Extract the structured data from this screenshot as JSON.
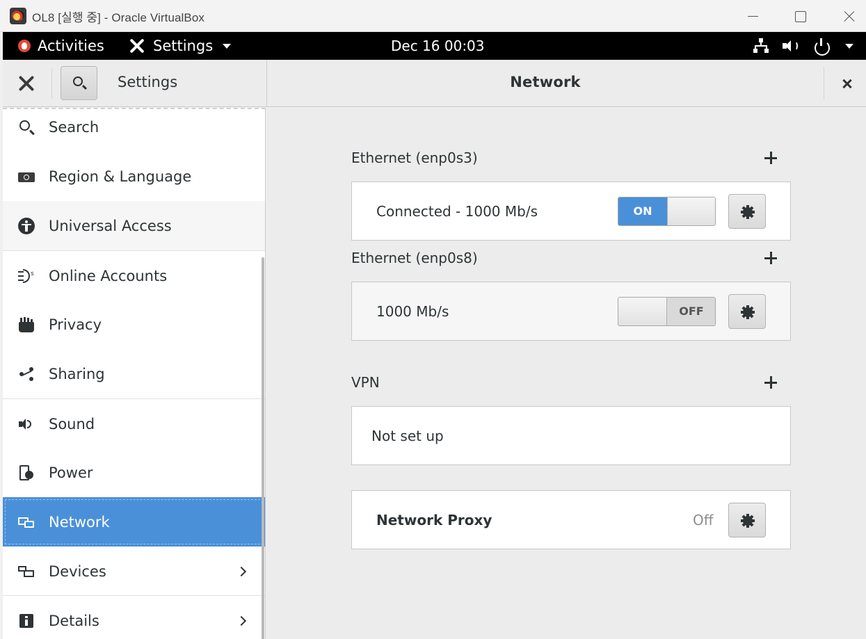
{
  "window": {
    "title": "OL8 [실행 중] - Oracle VirtualBox"
  },
  "topbar": {
    "activities_label": "Activities",
    "app_label": "Settings",
    "clock": "Dec 16  00:03"
  },
  "header": {
    "left_title": "Settings",
    "page_title": "Network"
  },
  "sidebar": {
    "items": [
      {
        "label": "Search",
        "icon": "search-icon"
      },
      {
        "label": "Region & Language",
        "icon": "region-icon"
      },
      {
        "label": "Universal Access",
        "icon": "universal-access-icon"
      },
      {
        "label": "Online Accounts",
        "icon": "online-accounts-icon"
      },
      {
        "label": "Privacy",
        "icon": "privacy-hand-icon"
      },
      {
        "label": "Sharing",
        "icon": "share-icon"
      },
      {
        "label": "Sound",
        "icon": "speaker-icon"
      },
      {
        "label": "Power",
        "icon": "power-plug-icon"
      },
      {
        "label": "Network",
        "icon": "network-icon",
        "selected": true
      },
      {
        "label": "Devices",
        "icon": "devices-icon",
        "has_chevron": true
      },
      {
        "label": "Details",
        "icon": "info-icon",
        "has_chevron": true
      }
    ]
  },
  "main": {
    "ethernet1": {
      "title": "Ethernet (enp0s3)",
      "status": "Connected - 1000 Mb/s",
      "toggle_label": "ON",
      "toggle_on": true
    },
    "ethernet2": {
      "title": "Ethernet (enp0s8)",
      "status": "1000 Mb/s",
      "toggle_label": "OFF",
      "toggle_on": false
    },
    "vpn": {
      "title": "VPN",
      "status": "Not set up"
    },
    "proxy": {
      "title": "Network Proxy",
      "status": "Off"
    }
  },
  "colors": {
    "accent": "#4a90d9",
    "topbar_bg": "#000000",
    "content_bg": "#ececec"
  }
}
